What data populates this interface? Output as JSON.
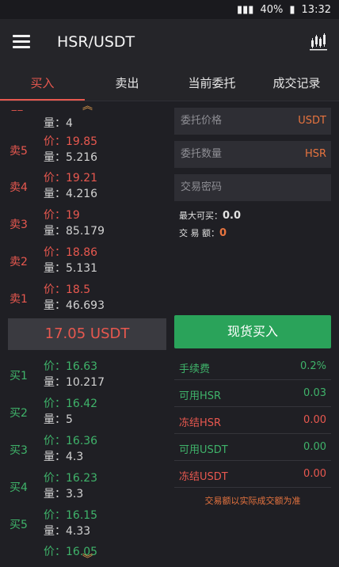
{
  "status_bar": {
    "battery": "40%",
    "time": "13:32"
  },
  "app_bar": {
    "title": "HSR/USDT",
    "menu_icon": "hamburger-menu-icon",
    "chart_icon": "candlestick-chart-icon"
  },
  "tabs": [
    {
      "label": "买入",
      "active": true
    },
    {
      "label": "卖出",
      "active": false
    },
    {
      "label": "当前委托",
      "active": false
    },
    {
      "label": "成交记录",
      "active": false
    }
  ],
  "orderbook": {
    "partial_top_qty": "量：4",
    "sell_rows": [
      {
        "label": "卖5",
        "price": "价：19.85",
        "qty": "量：5.216"
      },
      {
        "label": "卖4",
        "price": "价：19.21",
        "qty": "量：4.216"
      },
      {
        "label": "卖3",
        "price": "价：19",
        "qty": "量：85.179"
      },
      {
        "label": "卖2",
        "price": "价：18.86",
        "qty": "量：5.131"
      },
      {
        "label": "卖1",
        "price": "价：18.5",
        "qty": "量：46.693"
      }
    ],
    "current_price": "17.05 USDT",
    "buy_rows": [
      {
        "label": "买1",
        "price": "价：16.63",
        "qty": "量：10.217"
      },
      {
        "label": "买2",
        "price": "价：16.42",
        "qty": "量：5"
      },
      {
        "label": "买3",
        "price": "价：16.36",
        "qty": "量：4.3"
      },
      {
        "label": "买4",
        "price": "价：16.23",
        "qty": "量：3.3"
      },
      {
        "label": "买5",
        "price": "价：16.15",
        "qty": "量：4.33"
      }
    ],
    "partial_bottom_price": "价：16.05"
  },
  "form": {
    "price_placeholder": "委托价格",
    "price_unit": "USDT",
    "qty_placeholder": "委托数量",
    "qty_unit": "HSR",
    "password_placeholder": "交易密码",
    "max_buy_label": "最大可买：",
    "max_buy_value": "0.0",
    "amount_label": "交 易 额：",
    "amount_value": "0",
    "buy_button": "现货买入"
  },
  "account": [
    {
      "key": "手续费",
      "value": "0.2%",
      "tone": "green"
    },
    {
      "key": "可用HSR",
      "value": "0.03",
      "tone": "green"
    },
    {
      "key": "冻结HSR",
      "value": "0.00",
      "tone": "red"
    },
    {
      "key": "可用USDT",
      "value": "0.00",
      "tone": "green"
    },
    {
      "key": "冻结USDT",
      "value": "0.00",
      "tone": "red"
    }
  ],
  "note": "交易额以实际成交额为准",
  "colors": {
    "sell": "#e8584f",
    "buy": "#3fb36a",
    "accent": "#e8743f",
    "background": "#1f1f24"
  }
}
